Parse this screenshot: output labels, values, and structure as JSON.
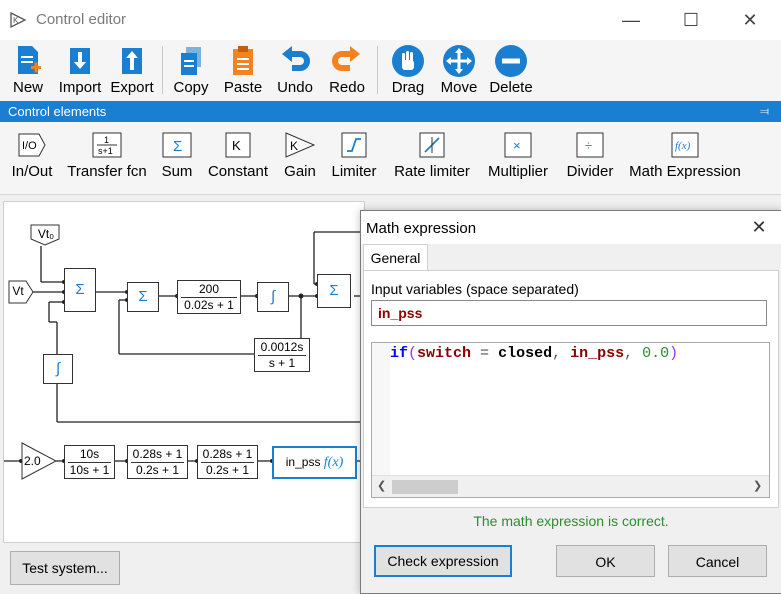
{
  "window": {
    "title": "Control editor",
    "icon": "control-editor-icon",
    "minimize": "—",
    "maximize": "☐",
    "close": "✕"
  },
  "toolbar": {
    "buttons": [
      {
        "label": "New",
        "icon": "new-file-icon"
      },
      {
        "label": "Import",
        "icon": "import-icon"
      },
      {
        "label": "Export",
        "icon": "export-icon"
      },
      {
        "label": "Copy",
        "icon": "copy-icon"
      },
      {
        "label": "Paste",
        "icon": "paste-icon"
      },
      {
        "label": "Undo",
        "icon": "undo-icon"
      },
      {
        "label": "Redo",
        "icon": "redo-icon"
      },
      {
        "label": "Drag",
        "icon": "hand-icon"
      },
      {
        "label": "Move",
        "icon": "move-arrows-icon"
      },
      {
        "label": "Delete",
        "icon": "delete-icon"
      }
    ]
  },
  "control_elements": {
    "title": "Control elements",
    "pin": "⫤",
    "items": [
      {
        "label": "In/Out",
        "symbol": "I/O"
      },
      {
        "label": "Transfer fcn",
        "symbol_num": "1",
        "symbol_den": "s+1"
      },
      {
        "label": "Sum",
        "symbol": "Σ"
      },
      {
        "label": "Constant",
        "symbol": "K"
      },
      {
        "label": "Gain",
        "symbol": "K"
      },
      {
        "label": "Limiter",
        "symbol": "∫"
      },
      {
        "label": "Rate limiter",
        "symbol": "∕"
      },
      {
        "label": "Multiplier",
        "symbol": "×"
      },
      {
        "label": "Divider",
        "symbol": "÷"
      },
      {
        "label": "Math Expression",
        "symbol": "f(x)"
      }
    ]
  },
  "diagram": {
    "input_vto": "Vt₀",
    "input_vt": "Vt",
    "sum_symbol": "Σ",
    "limiter_symbol": "∫",
    "tf1_num": "200",
    "tf1_den": "0.02s + 1",
    "tf2_num": "0.0012s",
    "tf2_den": "s + 1",
    "gain": "2.0",
    "tf3_num": "10s",
    "tf3_den": "10s + 1",
    "tf4_num": "0.28s + 1",
    "tf4_den": "0.2s + 1",
    "tf5_num": "0.28s + 1",
    "tf5_den": "0.2s + 1",
    "math_block_var": "in_pss",
    "math_block_fx": "f(x)"
  },
  "test_system_label": "Test system...",
  "dialog": {
    "title": "Math expression",
    "close": "✕",
    "tab": "General",
    "input_label": "Input variables (space separated)",
    "input_value": "in_pss",
    "code": {
      "kw": "if",
      "open": "(",
      "var1": "switch",
      "eq": " = ",
      "val": "closed",
      "c1": ", ",
      "var2": "in_pss",
      "c2": ", ",
      "num": "0.0",
      "close": ")"
    },
    "status": "The math expression is correct.",
    "check_button": "Check expression",
    "ok_button": "OK",
    "cancel_button": "Cancel"
  },
  "colors": {
    "accent": "#1a7fd0",
    "success": "#2e8b2e",
    "keyword": "#0000ff",
    "variable": "#8b0000",
    "number": "#2e8b2e",
    "paren": "#9b30ff",
    "icon_blue": "#1a7fd0",
    "icon_orange": "#f58220"
  }
}
